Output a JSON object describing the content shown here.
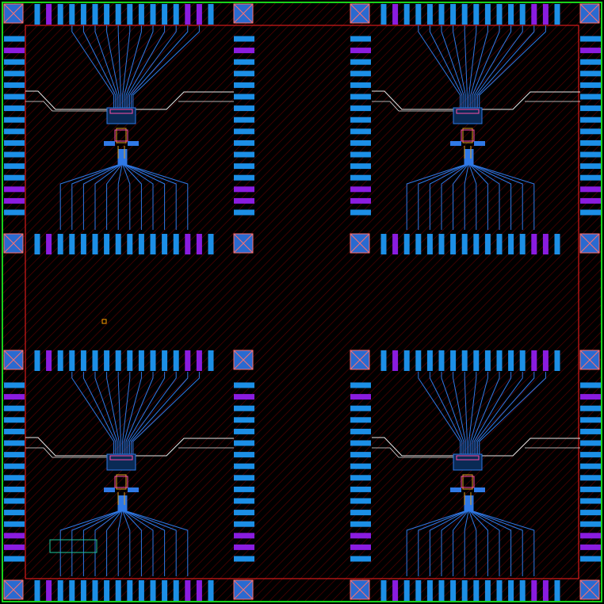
{
  "colors": {
    "background": "#000000",
    "hatch": "#5a0000",
    "die_outline": "#ff2020",
    "chip_boundary": "#19d219",
    "pad_blue": "#1c8fe6",
    "pad_purple": "#8a1ce0",
    "corner_fill": "#2a6ad0",
    "corner_outline": "#ff7070",
    "route_blue": "#2f79e6",
    "route_white": "#e8e8e8",
    "device_gold": "#e0a020",
    "device_pink": "#ff4da6",
    "marker_orange": "#ffa000",
    "label_box": "#1ec59a"
  },
  "layout_view": {
    "quadrants": [
      {
        "id": "top-left"
      },
      {
        "id": "top-right"
      },
      {
        "id": "bottom-left"
      },
      {
        "id": "bottom-right"
      }
    ],
    "pads_per_side": 16,
    "purple_pad_pattern": [
      0,
      1,
      0,
      0,
      0,
      0,
      0,
      0,
      0,
      0,
      0,
      0,
      0,
      1,
      1,
      0
    ]
  }
}
